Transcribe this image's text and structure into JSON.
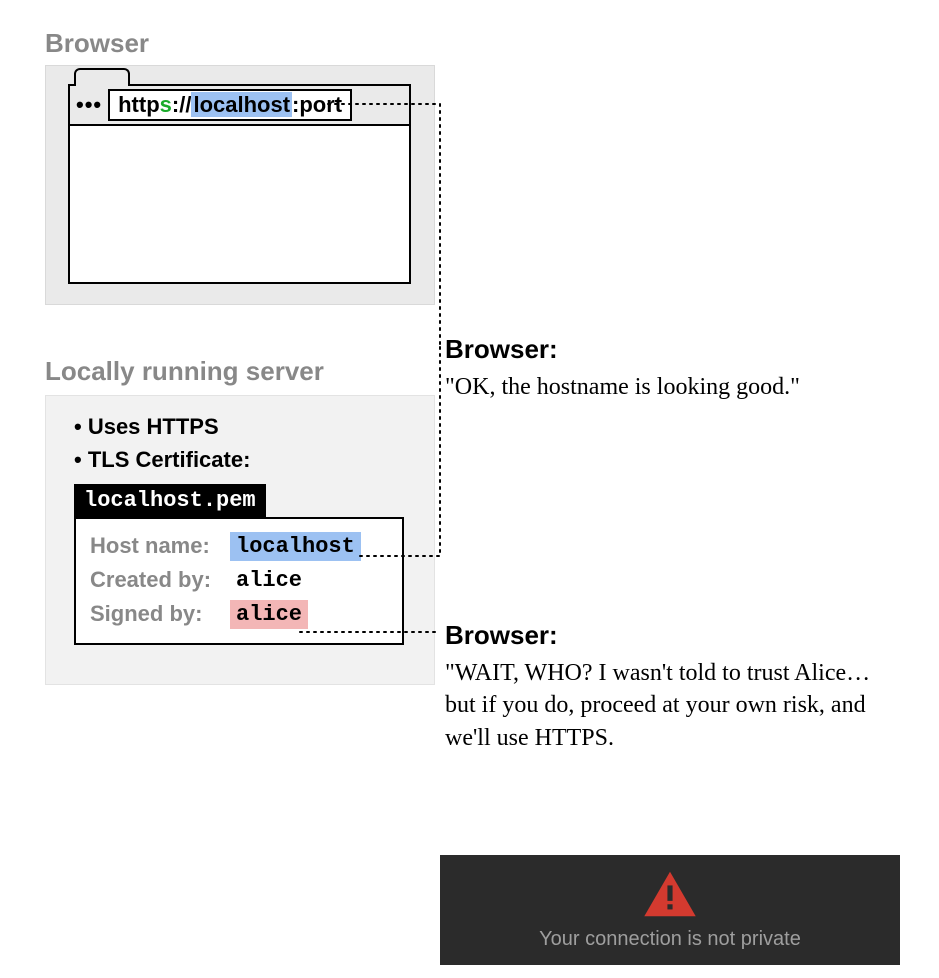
{
  "sections": {
    "browser_title": "Browser",
    "server_title": "Locally running server"
  },
  "browser": {
    "url_dots": "•••",
    "url_http": "http",
    "url_s": "s",
    "url_sep": "://",
    "url_host": "localhost",
    "url_portsep": ":",
    "url_port": "port"
  },
  "server": {
    "bullet_https": "Uses HTTPS",
    "bullet_tls": "TLS Certificate:",
    "filename": "localhost.pem",
    "cert": {
      "host_label": "Host name:",
      "host_value": "localhost",
      "created_label": "Created by:",
      "created_value": "alice",
      "signed_label": "Signed by:",
      "signed_value": "alice"
    }
  },
  "callouts": {
    "who": "Browser:",
    "ok_text": "\"OK, the hostname is looking good.\"",
    "wait_text": "\"WAIT, WHO? I wasn't told to trust Alice… but if you do, proceed at your own risk, and we'll use HTTPS."
  },
  "warning": {
    "text": "Your connection is not private"
  }
}
